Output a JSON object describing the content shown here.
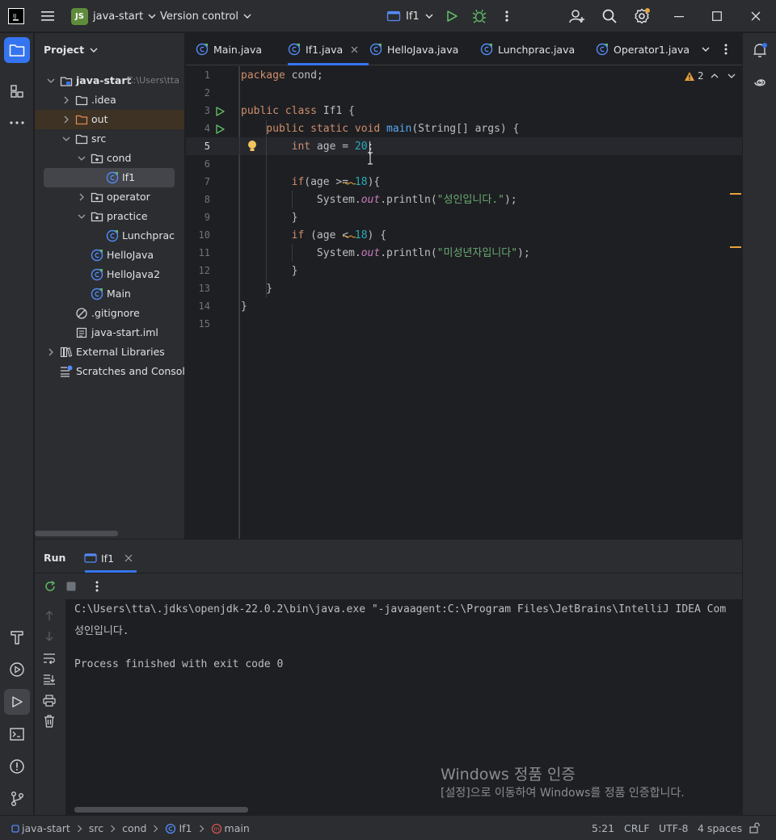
{
  "titlebar": {
    "project_badge": "JS",
    "project_name": "java-start",
    "vcs": "Version control",
    "run_config": "If1"
  },
  "project": {
    "title": "Project",
    "tree": [
      {
        "label": "java-start",
        "hint": "C:\\Users\\tta",
        "type": "module",
        "depth": 0,
        "expanded": true
      },
      {
        "label": ".idea",
        "type": "folder",
        "depth": 1,
        "expanded": false
      },
      {
        "label": "out",
        "type": "folder-orange",
        "depth": 1,
        "expanded": false
      },
      {
        "label": "src",
        "type": "folder",
        "depth": 1,
        "expanded": true
      },
      {
        "label": "cond",
        "type": "package",
        "depth": 2,
        "expanded": true
      },
      {
        "label": "If1",
        "type": "class",
        "depth": 3,
        "selected": true
      },
      {
        "label": "operator",
        "type": "package",
        "depth": 2,
        "expanded": false
      },
      {
        "label": "practice",
        "type": "package",
        "depth": 2,
        "expanded": true
      },
      {
        "label": "Lunchprac",
        "type": "class",
        "depth": 3
      },
      {
        "label": "HelloJava",
        "type": "class",
        "depth": 2
      },
      {
        "label": "HelloJava2",
        "type": "class",
        "depth": 2
      },
      {
        "label": "Main",
        "type": "class",
        "depth": 2
      },
      {
        "label": ".gitignore",
        "type": "ignore",
        "depth": 1
      },
      {
        "label": "java-start.iml",
        "type": "file",
        "depth": 1
      },
      {
        "label": "External Libraries",
        "type": "libs",
        "depth": 0,
        "expanded": false
      },
      {
        "label": "Scratches and Consoles",
        "type": "scratch",
        "depth": 0
      }
    ]
  },
  "editor": {
    "tabs": [
      {
        "label": "Main.java",
        "active": false
      },
      {
        "label": "If1.java",
        "active": true
      },
      {
        "label": "HelloJava.java",
        "active": false
      },
      {
        "label": "Lunchprac.java",
        "active": false
      },
      {
        "label": "Operator1.java",
        "active": false
      }
    ],
    "warnings_count": "2",
    "current_line": 5,
    "lines": [
      [
        {
          "t": "package ",
          "c": "kw"
        },
        {
          "t": "cond;",
          "c": ""
        }
      ],
      [],
      [
        {
          "t": "public class ",
          "c": "kw"
        },
        {
          "t": "If1 {",
          "c": ""
        }
      ],
      [
        {
          "t": "    public static void ",
          "c": "kw"
        },
        {
          "t": "main",
          "c": "fn"
        },
        {
          "t": "(String[] args) {",
          "c": ""
        }
      ],
      [
        {
          "t": "        int ",
          "c": "kw"
        },
        {
          "t": "age = ",
          "c": ""
        },
        {
          "t": "20",
          "c": "num"
        },
        {
          "t": ";",
          "c": ""
        }
      ],
      [],
      [
        {
          "t": "        if",
          "c": "kw"
        },
        {
          "t": "(age >= ",
          "c": ""
        },
        {
          "t": "18",
          "c": "num"
        },
        {
          "t": "){",
          "c": ""
        }
      ],
      [
        {
          "t": "            System.",
          "c": ""
        },
        {
          "t": "out",
          "c": "it"
        },
        {
          "t": ".println(",
          "c": ""
        },
        {
          "t": "\"성인입니다.\"",
          "c": "str"
        },
        {
          "t": ");",
          "c": ""
        }
      ],
      [
        {
          "t": "        }",
          "c": ""
        }
      ],
      [
        {
          "t": "        if ",
          "c": "kw"
        },
        {
          "t": "(age < ",
          "c": ""
        },
        {
          "t": "18",
          "c": "num"
        },
        {
          "t": ") {",
          "c": ""
        }
      ],
      [
        {
          "t": "            System.",
          "c": ""
        },
        {
          "t": "out",
          "c": "it"
        },
        {
          "t": ".println(",
          "c": ""
        },
        {
          "t": "\"미성년자입니다\"",
          "c": "str"
        },
        {
          "t": ");",
          "c": ""
        }
      ],
      [
        {
          "t": "        }",
          "c": ""
        }
      ],
      [
        {
          "t": "    }",
          "c": ""
        }
      ],
      [
        {
          "t": "}",
          "c": ""
        }
      ],
      []
    ]
  },
  "run": {
    "title": "Run",
    "tab_label": "If1",
    "output": [
      "C:\\Users\\tta\\.jdks\\openjdk-22.0.2\\bin\\java.exe \"-javaagent:C:\\Program Files\\JetBrains\\IntelliJ IDEA Com",
      "성인입니다.",
      "",
      "Process finished with exit code 0"
    ]
  },
  "watermark": {
    "line1": "Windows 정품 인증",
    "line2": "[설정]으로 이동하여 Windows를 정품 인증합니다."
  },
  "statusbar": {
    "breadcrumbs": [
      "java-start",
      "src",
      "cond",
      "If1",
      "main"
    ],
    "position": "5:21",
    "line_sep": "CRLF",
    "encoding": "UTF-8",
    "indent": "4 spaces"
  },
  "colors": {
    "accent": "#3574f0",
    "background": "#1e1f22",
    "panel": "#2b2d30",
    "run_green": "#5fb865",
    "warning": "#e6a23c"
  }
}
